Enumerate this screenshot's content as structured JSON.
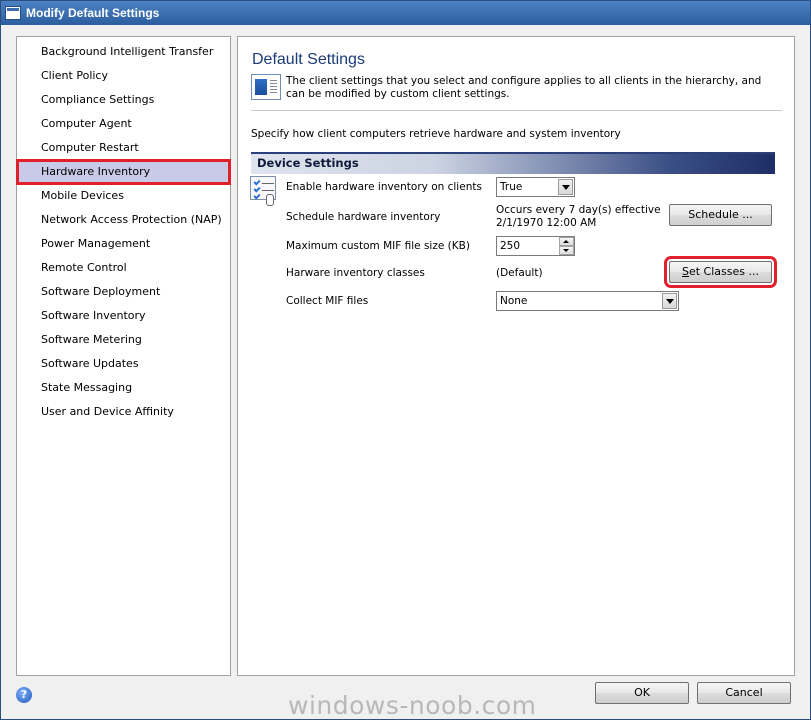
{
  "window": {
    "title": "Modify Default Settings"
  },
  "sidebar": {
    "items": [
      {
        "label": "Background Intelligent Transfer"
      },
      {
        "label": "Client Policy"
      },
      {
        "label": "Compliance Settings"
      },
      {
        "label": "Computer Agent"
      },
      {
        "label": "Computer Restart"
      },
      {
        "label": "Hardware Inventory",
        "selected": true
      },
      {
        "label": "Mobile Devices"
      },
      {
        "label": "Network Access Protection (NAP)"
      },
      {
        "label": "Power Management"
      },
      {
        "label": "Remote Control"
      },
      {
        "label": "Software Deployment"
      },
      {
        "label": "Software Inventory"
      },
      {
        "label": "Software Metering"
      },
      {
        "label": "Software Updates"
      },
      {
        "label": "State Messaging"
      },
      {
        "label": "User and Device Affinity"
      }
    ]
  },
  "main": {
    "title": "Default Settings",
    "description": "The client settings that you select and configure applies to all clients in the hierarchy, and can be modified by custom client settings.",
    "instruction": "Specify how client computers retrieve hardware and system inventory",
    "section_header": "Device Settings",
    "enable_label": "Enable hardware inventory on clients",
    "enable_value": "True",
    "schedule_label": "Schedule hardware inventory",
    "schedule_value_line1": "Occurs every 7 day(s) effective",
    "schedule_value_line2": "2/1/1970 12:00 AM",
    "schedule_button": "Schedule ...",
    "mif_size_label": "Maximum custom MIF file size (KB)",
    "mif_size_value": "250",
    "classes_label": "Harware inventory classes",
    "classes_value": "(Default)",
    "set_classes_button_accel": "S",
    "set_classes_button_rest": "et Classes ...",
    "collect_mif_label": "Collect MIF files",
    "collect_mif_value": "None"
  },
  "footer": {
    "ok_label": "OK",
    "cancel_label": "Cancel",
    "help_glyph": "?",
    "watermark": "windows-noob.com"
  },
  "colors": {
    "highlight_red": "#e0202a",
    "selected_bg": "#c9c9e8",
    "title_blue": "#1c3c78"
  },
  "icons": [
    "window-icon",
    "settings-document-icon",
    "checklist-icon",
    "help-icon"
  ]
}
